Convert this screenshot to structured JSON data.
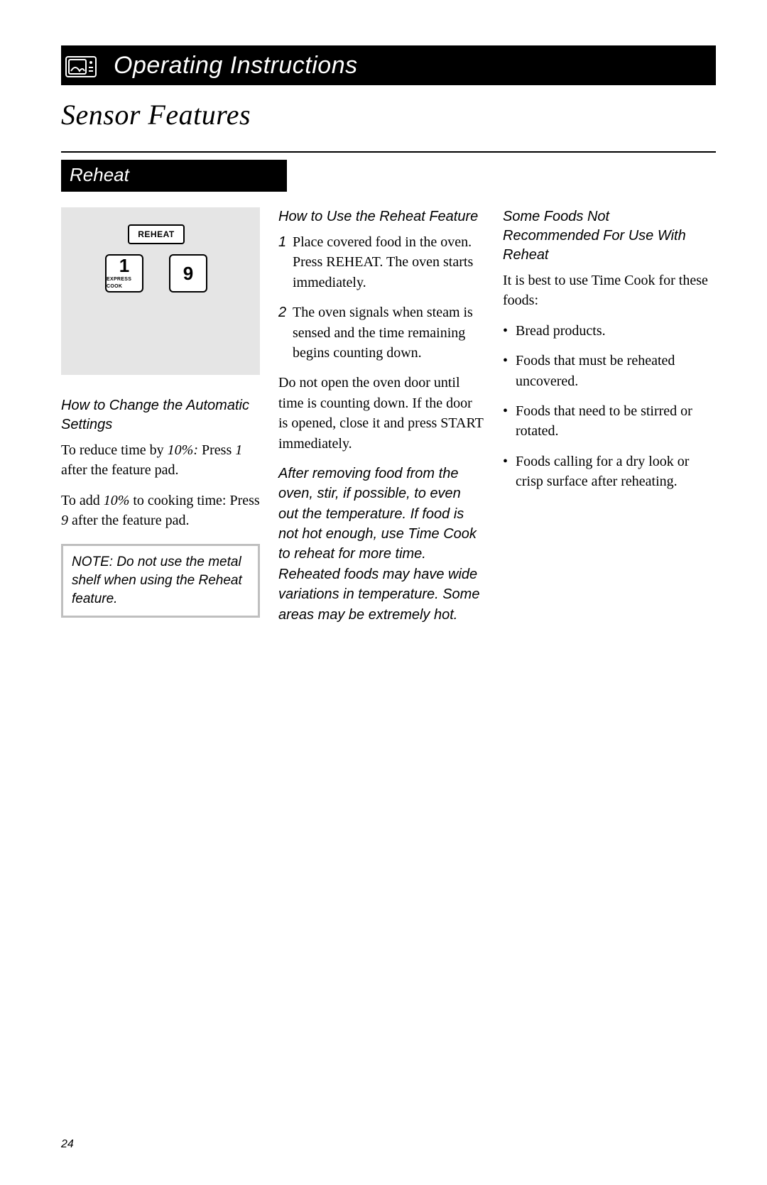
{
  "header": {
    "title": "Operating Instructions"
  },
  "page_title": "Sensor Features",
  "section": "Reheat",
  "diagram": {
    "reheat_label": "REHEAT",
    "btn1_big": "1",
    "btn1_small": "EXPRESS COOK",
    "btn9_big": "9"
  },
  "col1": {
    "sub": "How to Change the Automatic Settings",
    "p1a": "To reduce time by ",
    "p1b": "10%:",
    "p1c": " Press ",
    "p1d": "1",
    "p1e": " after the feature pad.",
    "p2a": "To add ",
    "p2b": "10%",
    "p2c": " to cooking time: Press ",
    "p2d": "9",
    "p2e": " after the feature pad.",
    "note": "NOTE: Do not use the metal shelf when using the Reheat feature."
  },
  "col2": {
    "sub": "How to Use the Reheat Feature",
    "s1n": "1",
    "s1t": "Place covered food in the oven. Press REHEAT. The oven starts immediately.",
    "s2n": "2",
    "s2t": "The oven signals when steam is sensed and the time remaining begins counting down.",
    "p3": "Do not open the oven door until time is counting down. If the door is opened, close it and press START immediately.",
    "p4": "After removing food from the oven, stir, if possible, to even out the temperature. If food is not hot enough, use Time Cook to reheat for more time. Reheated foods may have wide variations in temperature. Some areas may be extremely hot."
  },
  "col3": {
    "sub": "Some Foods Not Recommended For Use With Reheat",
    "intro": "It is best to use Time Cook for these foods:",
    "b1": "Bread products.",
    "b2": "Foods that must be reheated uncovered.",
    "b3": "Foods that need to be stirred or rotated.",
    "b4": "Foods calling for a dry look or crisp surface after reheating."
  },
  "page_number": "24"
}
